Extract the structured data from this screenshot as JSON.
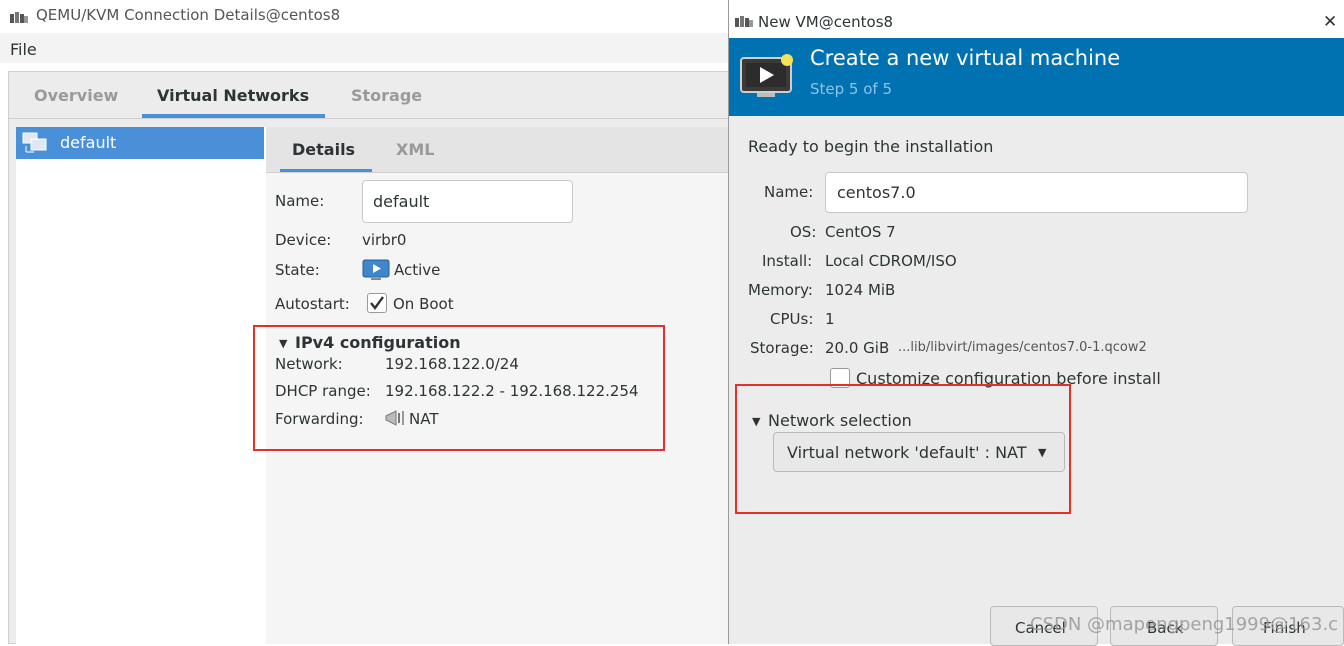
{
  "left_window": {
    "title": "QEMU/KVM Connection Details@centos8",
    "menu": {
      "file": "File"
    },
    "tabs": [
      "Overview",
      "Virtual Networks",
      "Storage"
    ],
    "network_list": [
      {
        "label": "default"
      }
    ],
    "sub_tabs": [
      "Details",
      "XML"
    ],
    "details": {
      "name_label": "Name:",
      "name_value": "default",
      "device_label": "Device:",
      "device_value": "virbr0",
      "state_label": "State:",
      "state_value": "Active",
      "autostart_label": "Autostart:",
      "autostart_value": "On Boot",
      "autostart_checked": true
    },
    "ipv4": {
      "header": "IPv4 configuration",
      "network_label": "Network:",
      "network_value": "192.168.122.0/24",
      "dhcp_label": "DHCP range:",
      "dhcp_value": "192.168.122.2 - 192.168.122.254",
      "forwarding_label": "Forwarding:",
      "forwarding_value": "NAT"
    }
  },
  "dialog": {
    "title": "New VM@centos8",
    "close": "✕",
    "heading": "Create a new virtual machine",
    "step": "Step 5 of 5",
    "ready_text": "Ready to begin the installation",
    "name_label": "Name:",
    "name_value": "centos7.0",
    "os_label": "OS:",
    "os_value": "CentOS 7",
    "install_label": "Install:",
    "install_value": "Local CDROM/ISO",
    "memory_label": "Memory:",
    "memory_value": "1024 MiB",
    "cpus_label": "CPUs:",
    "cpus_value": "1",
    "storage_label": "Storage:",
    "storage_size": "20.0 GiB",
    "storage_path": "...lib/libvirt/images/centos7.0-1.qcow2",
    "customize_label": "Customize configuration before install",
    "customize_checked": false,
    "network_section": "Network selection",
    "network_choice": "Virtual network 'default' : NAT",
    "buttons": {
      "cancel": "Cancel",
      "back": "Back",
      "finish": "Finish"
    }
  },
  "watermark": "CSDN @mapengpeng1999@163.c",
  "colors": {
    "accent": "#4a90d9",
    "banner": "#0072b1",
    "highlight": "#e0312b"
  }
}
